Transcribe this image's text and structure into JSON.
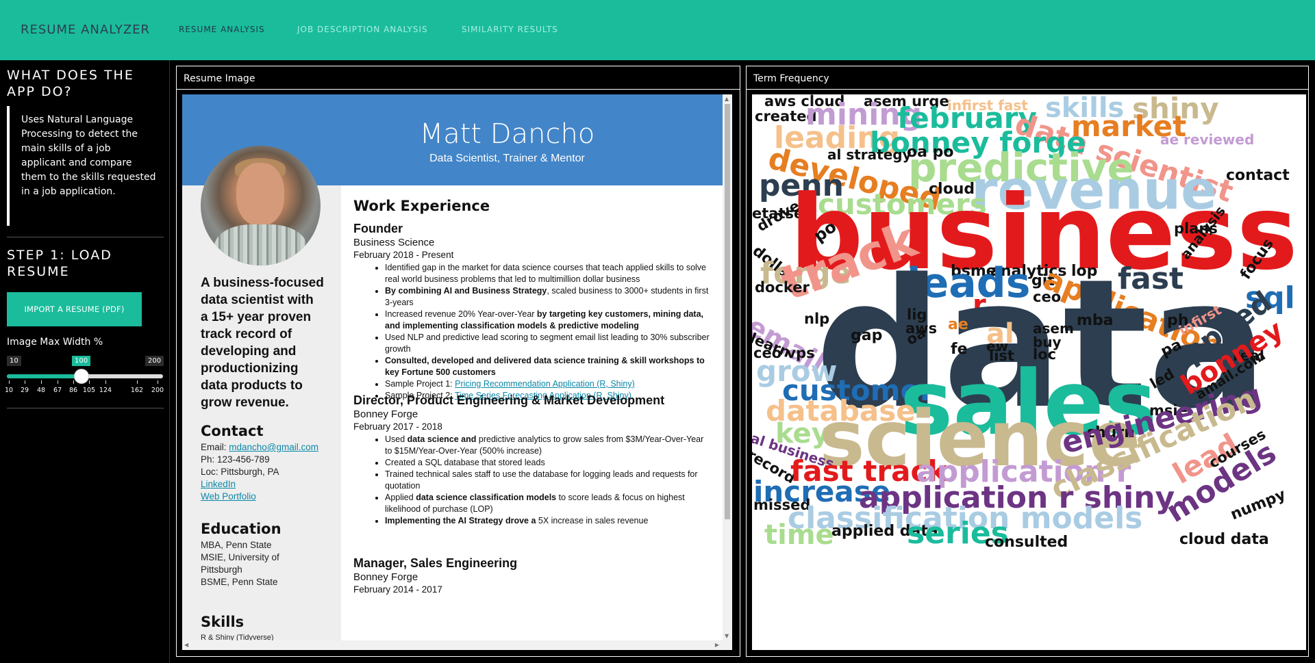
{
  "navbar": {
    "brand": "RESUME ANALYZER",
    "tabs": [
      {
        "label": "RESUME ANALYSIS",
        "active": true
      },
      {
        "label": "JOB DESCRIPTION ANALYSIS",
        "active": false
      },
      {
        "label": "SIMILARITY RESULTS",
        "active": false
      }
    ]
  },
  "sidebar": {
    "heading_what": "WHAT DOES THE APP DO?",
    "description": "Uses Natural Language Processing to detect the main skills of a job applicant and compare them to the skills requested in a job application.",
    "heading_step1": "STEP 1: LOAD RESUME",
    "import_button": "IMPORT A RESUME (PDF)",
    "slider": {
      "label": "Image Max Width %",
      "min": "10",
      "max": "200",
      "value": "100",
      "value_fraction": 0.474,
      "ticks": [
        "10",
        "29",
        "48",
        "67",
        "86",
        "105",
        "124",
        "162",
        "200"
      ]
    }
  },
  "resume_panel": {
    "title": "Resume Image",
    "resume": {
      "name": "Matt Dancho",
      "subtitle": "Data Scientist, Trainer & Mentor",
      "summary": "A business-focused data scientist with a 15+ year proven track record of developing and productionizing data products to grow revenue.",
      "contact_heading": "Contact",
      "email_label": "Email: ",
      "email": "mdancho@gmail.com",
      "phone": "Ph: 123-456-789",
      "location": "Loc: Pittsburgh, PA",
      "linkedin": "LinkedIn",
      "portfolio": "Web Portfolio",
      "education_heading": "Education",
      "education": [
        "MBA, Penn State",
        "MSIE, University of",
        "Pittsburgh",
        "BSME, Penn State"
      ],
      "skills_heading": "Skills",
      "skills_peek": "R & Shiny (Tidyverse)",
      "work_heading": "Work Experience",
      "jobs": [
        {
          "title": "Founder",
          "company": "Business Science",
          "dates": "February 2018 - Present",
          "bullets": [
            {
              "pre": "Identified gap in the market for data science courses that teach applied skills to solve real world business problems that led to multimillion dollar business",
              "bold": "",
              "post": ""
            },
            {
              "pre": "",
              "bold": "By combining AI and Business Strategy",
              "post": ", scaled business to 3000+ students in first 3-years"
            },
            {
              "pre": "Increased revenue 20% Year-over-Year ",
              "bold": "by targeting key customers, mining data, and implementing classification models & predictive modeling",
              "post": ""
            },
            {
              "pre": "Used NLP and predictive lead scoring to segment email list leading to 30% subscriber growth",
              "bold": "",
              "post": ""
            },
            {
              "pre": "",
              "bold": "Consulted, developed and delivered data science training & skill workshops to key Fortune 500 customers",
              "post": ""
            },
            {
              "pre": "Sample Project 1: ",
              "link": "Pricing Recommendation Application (R, Shiny)"
            },
            {
              "pre": "Sample Project 2: ",
              "link": "Time Series Forecasting Application (R, Shiny)"
            }
          ]
        },
        {
          "title": "Director, Product Engineering & Market Development",
          "company": "Bonney Forge",
          "dates": "February 2017 - 2018",
          "bullets": [
            {
              "pre": "Used ",
              "bold": "data science and",
              "post": " predictive analytics to grow sales from $3M/Year-Over-Year to $15M/Year-Over-Year (500% increase)"
            },
            {
              "pre": "Created a SQL database that stored leads",
              "bold": "",
              "post": ""
            },
            {
              "pre": "Trained technical sales staff to use the database for logging leads and requests for quotation",
              "bold": "",
              "post": ""
            },
            {
              "pre": "Applied ",
              "bold": "data science classification models",
              "post": " to score leads & focus on highest likelihood of purchase (LOP)"
            },
            {
              "pre": "",
              "bold": "Implementing the AI Strategy drove a",
              "post": " 5X increase in sales revenue"
            }
          ]
        },
        {
          "title": "Manager, Sales Engineering",
          "company": "Bonney Forge",
          "dates": "February 2014 - 2017",
          "bullets": []
        }
      ]
    }
  },
  "wordcloud_panel": {
    "title": "Term Frequency",
    "words": [
      {
        "text": "aws cloud",
        "color": "#111111"
      },
      {
        "text": "asem urge",
        "color": "#111111"
      },
      {
        "text": "infirst fast",
        "color": "#f5c08a"
      },
      {
        "text": "skills",
        "color": "#a9cce3"
      },
      {
        "text": "shiny",
        "color": "#c9b98f"
      },
      {
        "text": "created",
        "color": "#111111"
      },
      {
        "text": "mining",
        "color": "#c39bd3"
      },
      {
        "text": "february",
        "color": "#1abc9c"
      },
      {
        "text": "data scientist",
        "color": "#f1948a"
      },
      {
        "text": "market",
        "color": "#e67e22"
      },
      {
        "text": "ae reviewed",
        "color": "#c39bd3"
      },
      {
        "text": "leading",
        "color": "#f5c08a"
      },
      {
        "text": "bonney forge",
        "color": "#1abc9c"
      },
      {
        "text": "al strategy",
        "color": "#111111"
      },
      {
        "text": "oa po",
        "color": "#111111"
      },
      {
        "text": "predictive",
        "color": "#a9dc8f"
      },
      {
        "text": "contact",
        "color": "#111111"
      },
      {
        "text": "developed",
        "color": "#e67e22"
      },
      {
        "text": "penn",
        "color": "#2c3e50"
      },
      {
        "text": "cloud",
        "color": "#111111"
      },
      {
        "text": "revenue",
        "color": "#a9cce3"
      },
      {
        "text": "customers",
        "color": "#a9dc8f"
      },
      {
        "text": "etatse",
        "color": "#111111"
      },
      {
        "text": "drove",
        "color": "#111111"
      },
      {
        "text": "business",
        "color": "#e31a1c"
      },
      {
        "text": "plans",
        "color": "#111111"
      },
      {
        "text": "po",
        "color": "#111111"
      },
      {
        "text": "dollar",
        "color": "#111111"
      },
      {
        "text": "analysis",
        "color": "#111111"
      },
      {
        "text": "forge",
        "color": "#c9b98f"
      },
      {
        "text": "bsme",
        "color": "#111111"
      },
      {
        "text": "analytics",
        "color": "#111111"
      },
      {
        "text": "lop",
        "color": "#111111"
      },
      {
        "text": "focus",
        "color": "#111111"
      },
      {
        "text": "track",
        "color": "#f1948a"
      },
      {
        "text": "leads",
        "color": "#1f6db5"
      },
      {
        "text": "git",
        "color": "#111111"
      },
      {
        "text": "fast",
        "color": "#2c3e50"
      },
      {
        "text": "application",
        "color": "#e67e22"
      },
      {
        "text": "docker",
        "color": "#111111"
      },
      {
        "text": "ceo",
        "color": "#111111"
      },
      {
        "text": "sql",
        "color": "#1f6db5"
      },
      {
        "text": "email",
        "color": "#c39bd3"
      },
      {
        "text": "r",
        "color": "#e31a1c"
      },
      {
        "text": "data",
        "color": "#2c3e50"
      },
      {
        "text": "nlp",
        "color": "#111111"
      },
      {
        "text": "lig",
        "color": "#111111"
      },
      {
        "text": "mba",
        "color": "#111111"
      },
      {
        "text": "ph",
        "color": "#111111"
      },
      {
        "text": "learn",
        "color": "#111111"
      },
      {
        "text": "aws",
        "color": "#111111"
      },
      {
        "text": "ae",
        "color": "#e67e22"
      },
      {
        "text": "asem",
        "color": "#111111"
      },
      {
        "text": "infirst",
        "color": "#f1948a"
      },
      {
        "text": "gap",
        "color": "#111111"
      },
      {
        "text": "oa",
        "color": "#111111"
      },
      {
        "text": "al",
        "color": "#f5c08a"
      },
      {
        "text": "buy",
        "color": "#111111"
      },
      {
        "text": "ew",
        "color": "#111111"
      },
      {
        "text": "ceo vps",
        "color": "#111111"
      },
      {
        "text": "fe",
        "color": "#111111"
      },
      {
        "text": "list",
        "color": "#111111"
      },
      {
        "text": "loc",
        "color": "#111111"
      },
      {
        "text": "pa",
        "color": "#111111"
      },
      {
        "text": "applied",
        "color": "#2c3e50"
      },
      {
        "text": "real",
        "color": "#111111"
      },
      {
        "text": "grow",
        "color": "#a9cce3"
      },
      {
        "text": "led",
        "color": "#111111"
      },
      {
        "text": "customer",
        "color": "#1f6db5"
      },
      {
        "text": "sales",
        "color": "#1abc9c"
      },
      {
        "text": "bonney",
        "color": "#e31a1c"
      },
      {
        "text": "amail.com",
        "color": "#111111"
      },
      {
        "text": "msie",
        "color": "#111111"
      },
      {
        "text": "database",
        "color": "#f5c08a"
      },
      {
        "text": "key",
        "color": "#a9dc8f"
      },
      {
        "text": "science",
        "color": "#c9b98f"
      },
      {
        "text": "churn",
        "color": "#111111"
      },
      {
        "text": "engineering",
        "color": "#6c3483"
      },
      {
        "text": "al business",
        "color": "#6c3483"
      },
      {
        "text": "record",
        "color": "#111111"
      },
      {
        "text": "lead",
        "color": "#f1948a"
      },
      {
        "text": "courses",
        "color": "#111111"
      },
      {
        "text": "fast track",
        "color": "#e31a1c"
      },
      {
        "text": "application r",
        "color": "#c39bd3"
      },
      {
        "text": "increase",
        "color": "#1f6db5"
      },
      {
        "text": "classification",
        "color": "#c9b98f"
      },
      {
        "text": "application r shiny",
        "color": "#6c3483"
      },
      {
        "text": "missed",
        "color": "#111111"
      },
      {
        "text": "models",
        "color": "#6c3483"
      },
      {
        "text": "numpy",
        "color": "#111111"
      },
      {
        "text": "classification models",
        "color": "#a9cce3"
      },
      {
        "text": "time",
        "color": "#a9dc8f"
      },
      {
        "text": "applied data",
        "color": "#111111"
      },
      {
        "text": "series",
        "color": "#1abc9c"
      },
      {
        "text": "consulted",
        "color": "#111111"
      },
      {
        "text": "cloud data",
        "color": "#111111"
      }
    ]
  }
}
